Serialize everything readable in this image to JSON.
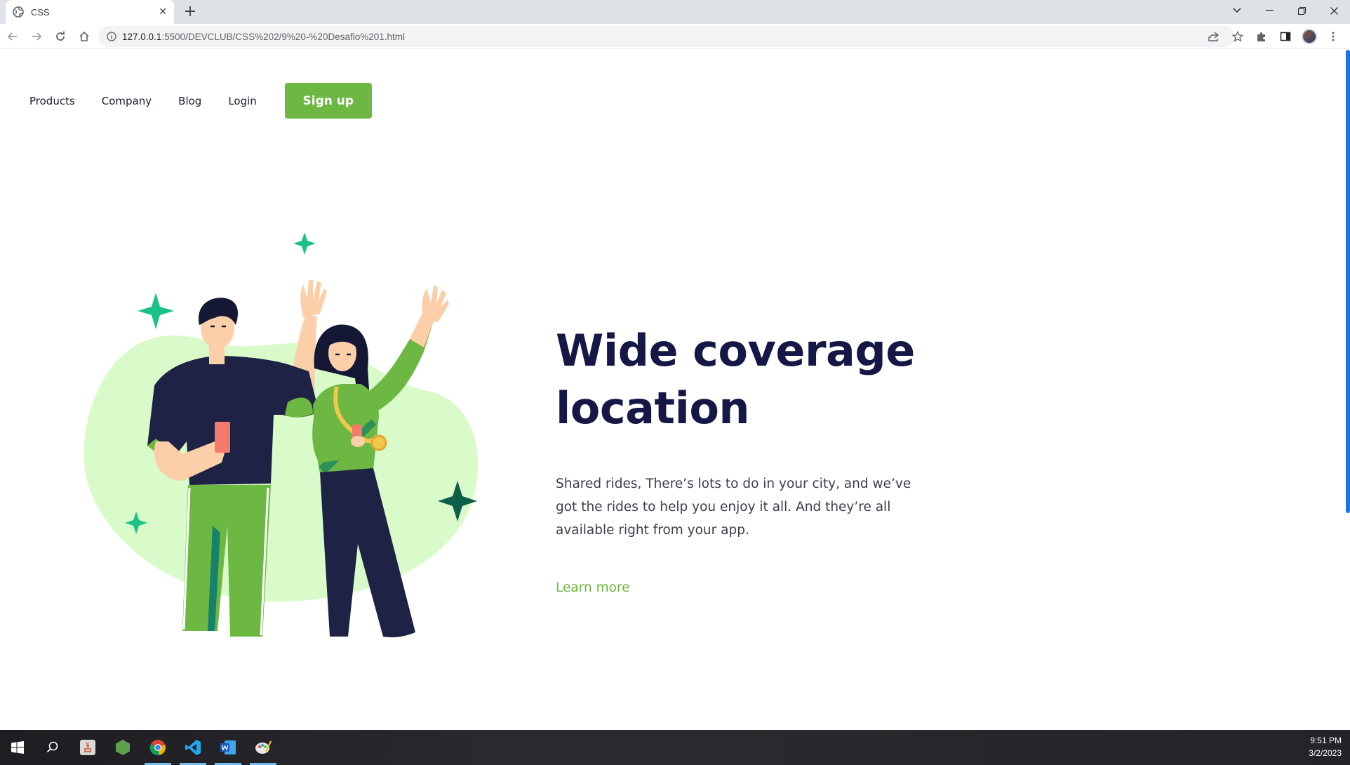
{
  "browser": {
    "tab_title": "CSS",
    "url_host": "127.0.0.1",
    "url_path": ":5500/DEVCLUB/CSS%202/9%20-%20Desafio%201.html"
  },
  "nav": {
    "items": [
      "Products",
      "Company",
      "Blog",
      "Login"
    ],
    "signup_label": "Sign up"
  },
  "hero": {
    "title_line1": "Wide coverage",
    "title_line2": "location",
    "description": "Shared rides, There’s lots to do in your city, and we’ve got the rides to help you enjoy it all. And they’re all available right from your app.",
    "link_label": "Learn more"
  },
  "taskbar": {
    "time": "9:51 PM",
    "date": "3/2/2023"
  },
  "colors": {
    "brand_green": "#6db743",
    "title_navy": "#151846",
    "blob_green": "#d8fbc9",
    "sparkle_teal": "#1ac28a"
  }
}
